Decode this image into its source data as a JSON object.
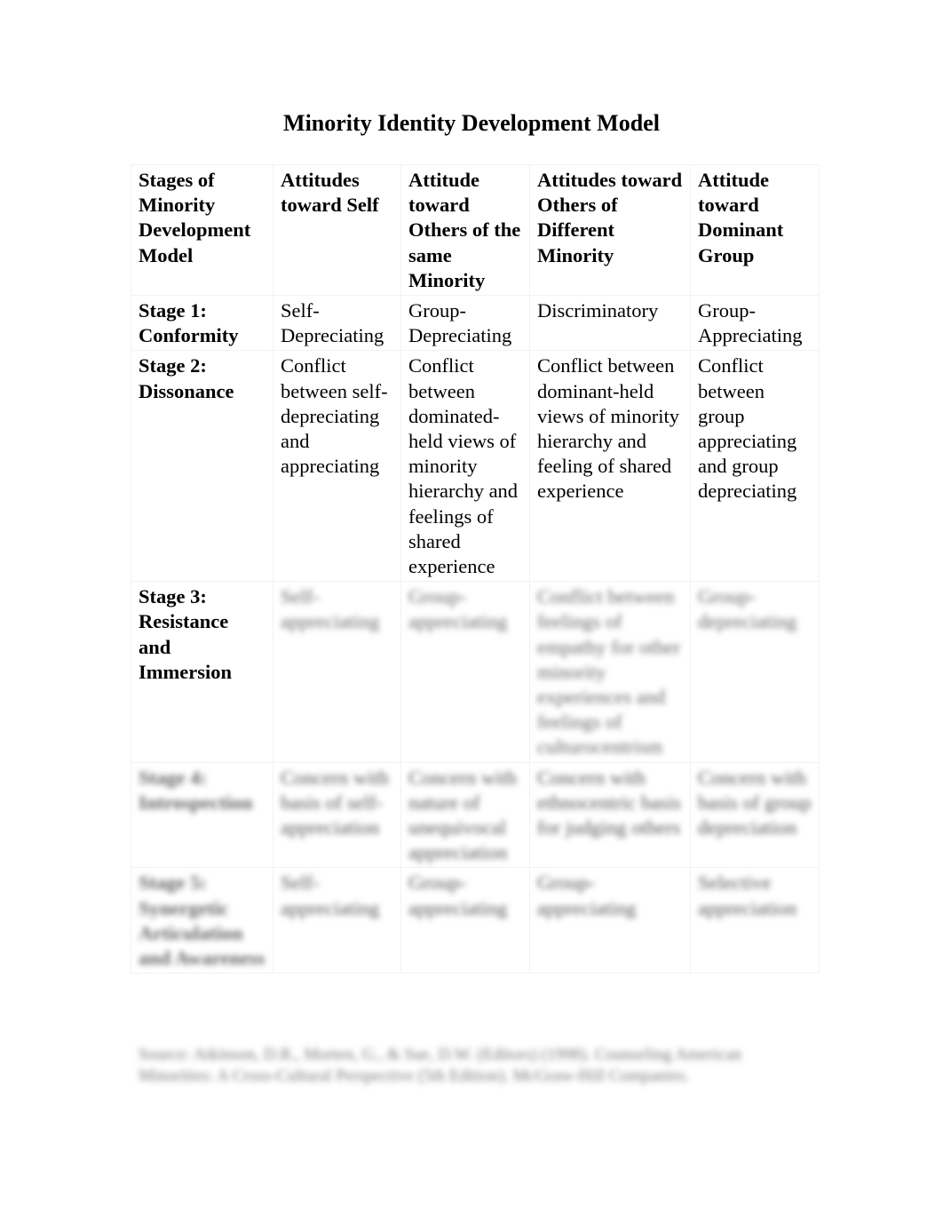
{
  "document": {
    "title": "Minority Identity Development Model",
    "table": {
      "headers": [
        "Stages of Minority Development Model",
        "Attitudes toward Self",
        "Attitude toward Others of the same Minority",
        "Attitudes toward Others of Different Minority",
        "Attitude toward Dominant Group"
      ],
      "rows": [
        {
          "stage": "Stage 1: Conformity",
          "self": "Self-Depreciating",
          "same_minority": "Group-Depreciating",
          "different_minority": "Discriminatory",
          "dominant_group": "Group-Appreciating"
        },
        {
          "stage": "Stage 2: Dissonance",
          "self": "Conflict between self-depreciating and appreciating",
          "same_minority": "Conflict between dominated-held views of minority hierarchy and feelings of shared experience",
          "different_minority": "Conflict between dominant-held views of minority hierarchy and feeling of shared experience",
          "dominant_group": "Conflict between group appreciating and group depreciating"
        },
        {
          "stage": "Stage 3: Resistance and Immersion",
          "self": "Self-appreciating",
          "same_minority": "Group-appreciating",
          "different_minority": "Conflict between feelings of empathy for other minority experiences and feelings of culturocentrism",
          "dominant_group": "Group-depreciating"
        },
        {
          "stage": "Stage 4: Introspection",
          "self": "Concern with basis of self-appreciation",
          "same_minority": "Concern with nature of unequivocal appreciation",
          "different_minority": "Concern with ethnocentric basis for judging others",
          "dominant_group": "Concern with basis of group depreciation"
        },
        {
          "stage": "Stage 5: Synergetic Articulation and Awareness",
          "self": "Self-appreciating",
          "same_minority": "Group-appreciating",
          "different_minority": "Group-appreciating",
          "dominant_group": "Selective appreciation"
        }
      ]
    },
    "source": "Source: Atkinson, D.R., Morten, G., & Sue, D.W. (Editors) (1998). Counseling American Minorities: A Cross-Cultural Perspective (5th Edition). McGraw-Hill Companies."
  }
}
